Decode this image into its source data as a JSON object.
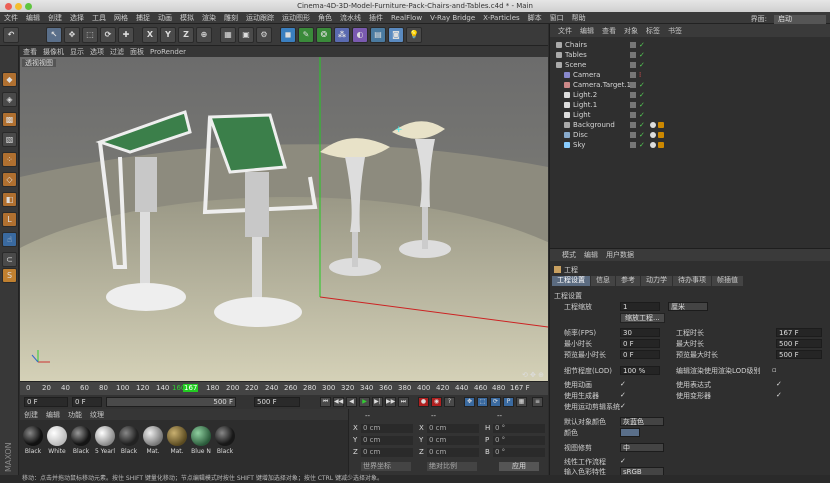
{
  "window": {
    "title": "Cinema-4D-3D-Model-Furniture-Pack-Chairs-and-Tables.c4d * - Main"
  },
  "menu": [
    "文件",
    "编辑",
    "创建",
    "选择",
    "工具",
    "网格",
    "捕捉",
    "动画",
    "模拟",
    "渲染",
    "雕刻",
    "运动跟踪",
    "运动图形",
    "角色",
    "流水线",
    "插件",
    "RealFlow",
    "V-Ray Bridge",
    "X-Particles",
    "脚本",
    "窗口",
    "帮助"
  ],
  "layout": {
    "label": "界面:",
    "value": "启动"
  },
  "toolbar": {
    "x": "X",
    "y": "Y",
    "z": "Z"
  },
  "viewport": {
    "menu": [
      "查看",
      "摄像机",
      "显示",
      "选项",
      "过滤",
      "面板",
      "ProRender"
    ],
    "label": "透视视图"
  },
  "timeline": {
    "ticks": [
      "0",
      "20",
      "40",
      "60",
      "80",
      "100",
      "120",
      "140",
      "160",
      "167",
      "180",
      "200",
      "220",
      "240",
      "260",
      "280",
      "300",
      "320",
      "340",
      "360",
      "380",
      "400",
      "420",
      "440",
      "460",
      "480",
      "500"
    ],
    "end": "167 F"
  },
  "transport": {
    "start": "0 F",
    "current": "0 F",
    "max": "500 F",
    "end": "500 F"
  },
  "materials": {
    "menu": [
      "创建",
      "编辑",
      "功能",
      "纹理"
    ],
    "items": [
      {
        "name": "Black",
        "color": "#111"
      },
      {
        "name": "White",
        "color": "#e0e0e0"
      },
      {
        "name": "Black",
        "color": "#151515"
      },
      {
        "name": "5 Yearl",
        "color": "#c8c8c8"
      },
      {
        "name": "Black",
        "color": "#222"
      },
      {
        "name": "Mat.",
        "color": "#aaa"
      },
      {
        "name": "Mat.",
        "color": "#7a6a3a"
      },
      {
        "name": "Blue N",
        "color": "#4a8a5a"
      },
      {
        "name": "Black",
        "color": "#181818"
      }
    ]
  },
  "coords": {
    "headers": [
      "--",
      "--",
      "--"
    ],
    "rows": [
      {
        "a": "X",
        "av": "0 cm",
        "b": "X",
        "bv": "0 cm",
        "c": "H",
        "cv": "0 °"
      },
      {
        "a": "Y",
        "av": "0 cm",
        "b": "Y",
        "bv": "0 cm",
        "c": "P",
        "cv": "0 °"
      },
      {
        "a": "Z",
        "av": "0 cm",
        "b": "Z",
        "bv": "0 cm",
        "c": "B",
        "cv": "0 °"
      }
    ],
    "mode": "世界坐标",
    "scale": "绝对比例",
    "apply": "应用"
  },
  "objects": {
    "menu": [
      "文件",
      "编辑",
      "查看",
      "对象",
      "标签",
      "书签"
    ],
    "items": [
      {
        "name": "Chairs",
        "color": "#aaa"
      },
      {
        "name": "Tables",
        "color": "#aaa"
      },
      {
        "name": "Scene",
        "color": "#aaa"
      },
      {
        "name": "Camera",
        "color": "#88c"
      },
      {
        "name": "Camera.Target.1",
        "color": "#c88"
      },
      {
        "name": "Light.2",
        "color": "#ddd"
      },
      {
        "name": "Light.1",
        "color": "#ddd"
      },
      {
        "name": "Light",
        "color": "#ddd"
      },
      {
        "name": "Background",
        "color": "#aaa"
      },
      {
        "name": "Disc",
        "color": "#8ac"
      },
      {
        "name": "Sky",
        "color": "#8cf"
      }
    ]
  },
  "attributes": {
    "menu": [
      "模式",
      "编辑",
      "用户数据"
    ],
    "object": "工程",
    "tabs": [
      "工程设置",
      "信息",
      "参考",
      "动力学",
      "待办事项",
      "帧插值"
    ],
    "section": "工程设置",
    "fields": {
      "scale_label": "工程缩放",
      "scale_val": "1",
      "scale_unit": "厘米",
      "scale_btn": "缩放工程...",
      "fps_label": "帧率(FPS)",
      "fps_val": "30",
      "min_label": "最小时长",
      "min_val": "0 F",
      "pmin_label": "预览最小时长",
      "pmin_val": "0 F",
      "len_label": "工程时长",
      "len_val": "167 F",
      "max_label": "最大时长",
      "max_val": "500 F",
      "pmax_label": "预览最大时长",
      "pmax_val": "500 F",
      "lod_label": "细节程度(LOD)",
      "lod_val": "100 %",
      "lod_right": "编辑渲染使用渲染LOD级别",
      "anim": "使用动画",
      "expr": "使用表达式",
      "gen": "使用生成器",
      "deform": "使用变形器",
      "motion": "使用运动剪辑系统",
      "objcolor_label": "默认对象颜色",
      "objcolor_val": "灰蓝色",
      "color_label": "颜色",
      "view_label": "视图修剪",
      "view_val": "中",
      "linear_label": "线性工作流程",
      "input_label": "输入色彩特性",
      "input_val": "sRGB"
    }
  },
  "status": "移动：点击并拖动鼠标移动元素。按住 SHIFT 键量化移动；节点编辑模式时按住 SHIFT 键增加选择对象；按住 CTRL 键减少选择对象。"
}
